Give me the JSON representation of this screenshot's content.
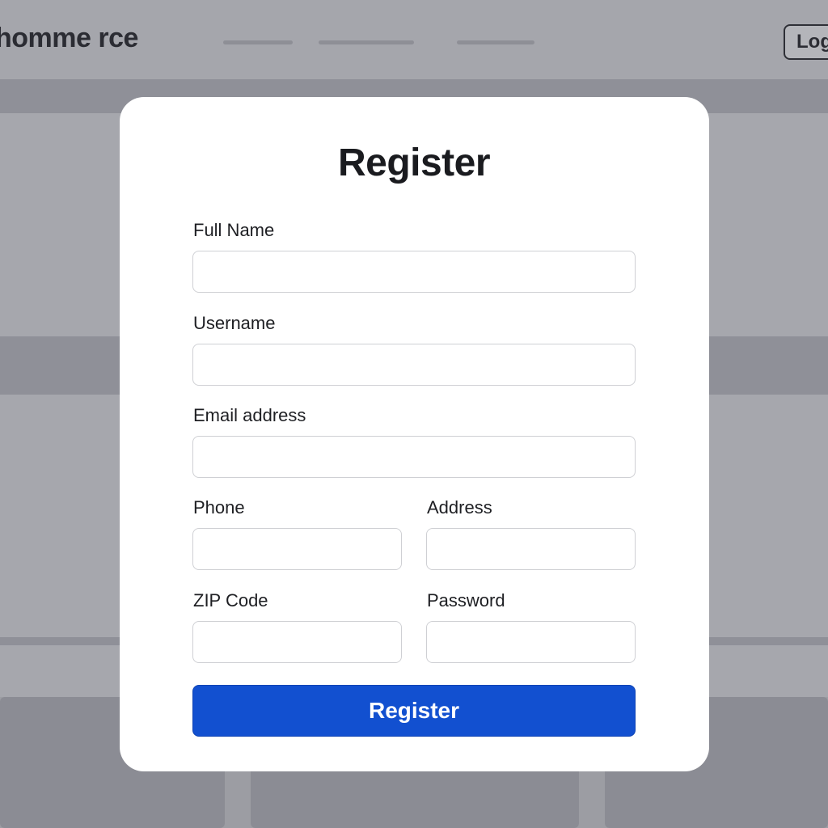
{
  "background": {
    "brand_name": "homme rce",
    "login_label": "Log"
  },
  "form": {
    "title": "Register",
    "fields": {
      "full_name": {
        "label": "Full Name",
        "value": "",
        "placeholder": ""
      },
      "username": {
        "label": "Username",
        "value": "",
        "placeholder": ""
      },
      "email": {
        "label": "Email address",
        "value": "",
        "placeholder": ""
      },
      "phone": {
        "label": "Phone",
        "value": "",
        "placeholder": ""
      },
      "address": {
        "label": "Address",
        "value": "",
        "placeholder": ""
      },
      "zip": {
        "label": "ZIP Code",
        "value": "",
        "placeholder": ""
      },
      "password": {
        "label": "Password",
        "value": "",
        "placeholder": ""
      }
    },
    "submit_label": "Register"
  },
  "colors": {
    "accent": "#1250d0",
    "overlay": "#a9aab0",
    "modal_bg": "#ffffff"
  }
}
